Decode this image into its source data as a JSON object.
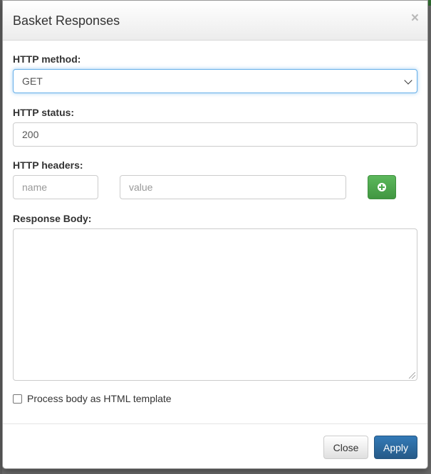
{
  "dialog": {
    "title": "Basket Responses",
    "close_symbol": "×"
  },
  "form": {
    "method": {
      "label": "HTTP method:",
      "selected": "GET"
    },
    "status": {
      "label": "HTTP status:",
      "value": "200"
    },
    "headers": {
      "label": "HTTP headers:",
      "name_placeholder": "name",
      "value_placeholder": "value",
      "add_icon": "plus-circle-icon"
    },
    "body": {
      "label": "Response Body:",
      "value": ""
    },
    "template_checkbox": {
      "label": "Process body as HTML template",
      "checked": false
    }
  },
  "footer": {
    "close_label": "Close",
    "apply_label": "Apply"
  },
  "colors": {
    "primary": "#337ab7",
    "success": "#5cb85c",
    "focus": "#66afe9"
  }
}
